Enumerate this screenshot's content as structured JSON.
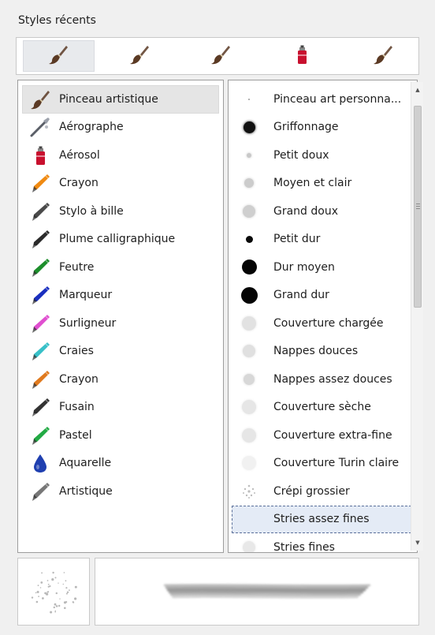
{
  "recent": {
    "title": "Styles récents",
    "slots": [
      {
        "icon": "brush-icon",
        "active": true
      },
      {
        "icon": "brush-icon",
        "active": false
      },
      {
        "icon": "brush-icon",
        "active": false
      },
      {
        "icon": "spray-can-icon",
        "active": false
      },
      {
        "icon": "brush-icon",
        "active": false
      }
    ]
  },
  "categories": [
    {
      "label": "Pinceau artistique",
      "icon": "art-brush-icon",
      "color": "#5b3a24",
      "selected": true
    },
    {
      "label": "Aérographe",
      "icon": "airbrush-icon",
      "color": "#5b5f68"
    },
    {
      "label": "Aérosol",
      "icon": "spray-can-icon",
      "color": "#c8102e"
    },
    {
      "label": "Crayon",
      "icon": "crayon-icon",
      "color": "#f08a12"
    },
    {
      "label": "Stylo à bille",
      "icon": "ballpoint-pen-icon",
      "color": "#4a4a4a"
    },
    {
      "label": "Plume calligraphique",
      "icon": "calligraphy-pen-icon",
      "color": "#2b2b2b"
    },
    {
      "label": "Feutre",
      "icon": "felt-pen-icon",
      "color": "#1c8e2b"
    },
    {
      "label": "Marqueur",
      "icon": "marker-icon",
      "color": "#1a2fbf"
    },
    {
      "label": "Surligneur",
      "icon": "highlighter-icon",
      "color": "#e04fd0"
    },
    {
      "label": "Craies",
      "icon": "chalk-icon",
      "color": "#38c0c8"
    },
    {
      "label": "Crayon",
      "icon": "pencil-icon",
      "color": "#e07a1e"
    },
    {
      "label": "Fusain",
      "icon": "charcoal-icon",
      "color": "#333333"
    },
    {
      "label": "Pastel",
      "icon": "pastel-icon",
      "color": "#22aa44"
    },
    {
      "label": "Aquarelle",
      "icon": "watercolor-drop-icon",
      "color": "#1f3fb0"
    },
    {
      "label": "Artistique",
      "icon": "artistic-pen-icon",
      "color": "#777777"
    }
  ],
  "presets": [
    {
      "label": "Pinceau art personna...",
      "dot_size": 2,
      "dot_color": "#9a9a9a"
    },
    {
      "label": "Griffonnage",
      "dot_size": 15,
      "dot_color": "#111111",
      "soft": true
    },
    {
      "label": "Petit doux",
      "dot_size": 6,
      "dot_color": "#c9c9c9",
      "soft": true
    },
    {
      "label": "Moyen et clair",
      "dot_size": 12,
      "dot_color": "#cccccc",
      "soft": true
    },
    {
      "label": "Grand doux",
      "dot_size": 16,
      "dot_color": "#cfcfcf",
      "soft": true
    },
    {
      "label": "Petit dur",
      "dot_size": 9,
      "dot_color": "#0a0a0a"
    },
    {
      "label": "Dur moyen",
      "dot_size": 19,
      "dot_color": "#050505"
    },
    {
      "label": "Grand dur",
      "dot_size": 21,
      "dot_color": "#050505"
    },
    {
      "label": "Couverture chargée",
      "dot_size": 18,
      "dot_color": "#e2e2e2",
      "soft": true
    },
    {
      "label": "Nappes douces",
      "dot_size": 16,
      "dot_color": "#e0e0e0",
      "soft": true
    },
    {
      "label": "Nappes assez douces",
      "dot_size": 14,
      "dot_color": "#d8d8d8",
      "soft": true
    },
    {
      "label": "Couverture sèche",
      "dot_size": 18,
      "dot_color": "#e6e6e6",
      "soft": true
    },
    {
      "label": "Couverture extra-fine",
      "dot_size": 18,
      "dot_color": "#e6e6e6",
      "soft": true
    },
    {
      "label": "Couverture Turin claire",
      "dot_size": 18,
      "dot_color": "#f1f1f1",
      "soft": true
    },
    {
      "label": "Crépi grossier",
      "dot_size": 18,
      "dot_color": "#d5d5d5",
      "textured": true
    },
    {
      "label": "Stries assez fines",
      "dot_size": 0,
      "dot_color": "#ffffff",
      "focused": true
    },
    {
      "label": "Stries fines",
      "dot_size": 16,
      "dot_color": "#e8e8e8",
      "soft": true
    }
  ],
  "preview": {
    "nib_icon": "nib-preview-icon",
    "stroke_icon": "stroke-preview-icon",
    "stroke_color": "#6e6e6e"
  }
}
